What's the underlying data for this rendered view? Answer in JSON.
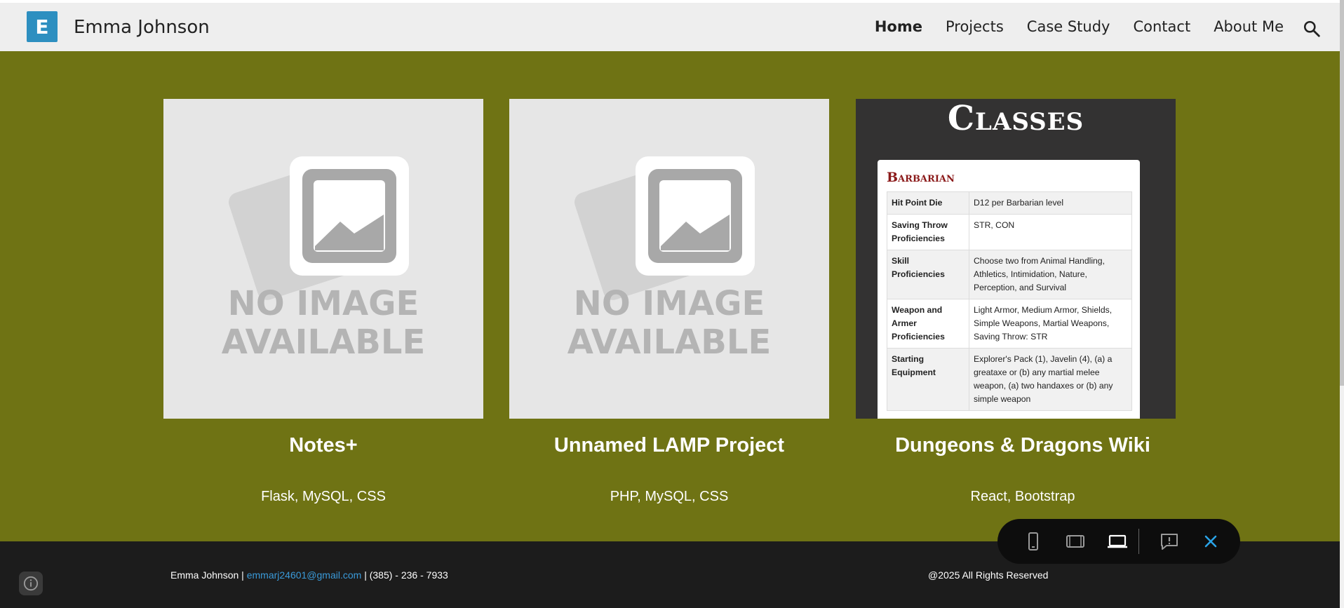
{
  "header": {
    "logo_letter": "E",
    "site_title": "Emma Johnson",
    "nav": [
      {
        "label": "Home",
        "active": true
      },
      {
        "label": "Projects"
      },
      {
        "label": "Case Study"
      },
      {
        "label": "Contact"
      },
      {
        "label": "About Me"
      }
    ],
    "search_icon": "search-icon"
  },
  "projects": [
    {
      "title": "Notes+",
      "tech": "Flask, MySQL, CSS",
      "image_text": [
        "NO IMAGE",
        "AVAILABLE"
      ]
    },
    {
      "title": "Unnamed LAMP Project",
      "tech": "PHP, MySQL, CSS",
      "image_text": [
        "NO IMAGE",
        "AVAILABLE"
      ]
    },
    {
      "title": "Dungeons & Dragons Wiki",
      "tech": "React, Bootstrap"
    }
  ],
  "dnd_preview": {
    "heading": "Classes",
    "class_name": "Barbarian",
    "rows": [
      {
        "key": "Hit Point Die",
        "value": "D12 per Barbarian level"
      },
      {
        "key": "Saving Throw Proficiencies",
        "value": "STR, CON"
      },
      {
        "key": "Skill Proficiencies",
        "value": "Choose two from Animal Handling, Athletics, Intimidation, Nature, Perception, and Survival"
      },
      {
        "key": "Weapon and Armer Proficiencies",
        "value": "Light Armor, Medium Armor, Shields, Simple Weapons, Martial Weapons, Saving Throw: STR"
      },
      {
        "key": "Starting Equipment",
        "value": "Explorer's Pack (1), Javelin (4), (a) a greataxe or (b) any martial melee weapon, (a) two handaxes or (b) any simple weapon"
      }
    ]
  },
  "footer": {
    "name": "Emma Johnson",
    "sep": "|",
    "email": "emmarj24601@gmail.com",
    "phone": "| (385) - 236 - 7933",
    "copyright": "@2025 All Rights Reserved"
  },
  "toolbar": {
    "icons": [
      "phone-view-icon",
      "tablet-view-icon",
      "laptop-view-icon",
      "feedback-icon",
      "close-icon"
    ]
  },
  "colors": {
    "accent_green": "#6f7314",
    "logo_blue": "#2d8fc0",
    "footer_bg": "#1c1c1c",
    "link_blue": "#3a9ad9"
  }
}
